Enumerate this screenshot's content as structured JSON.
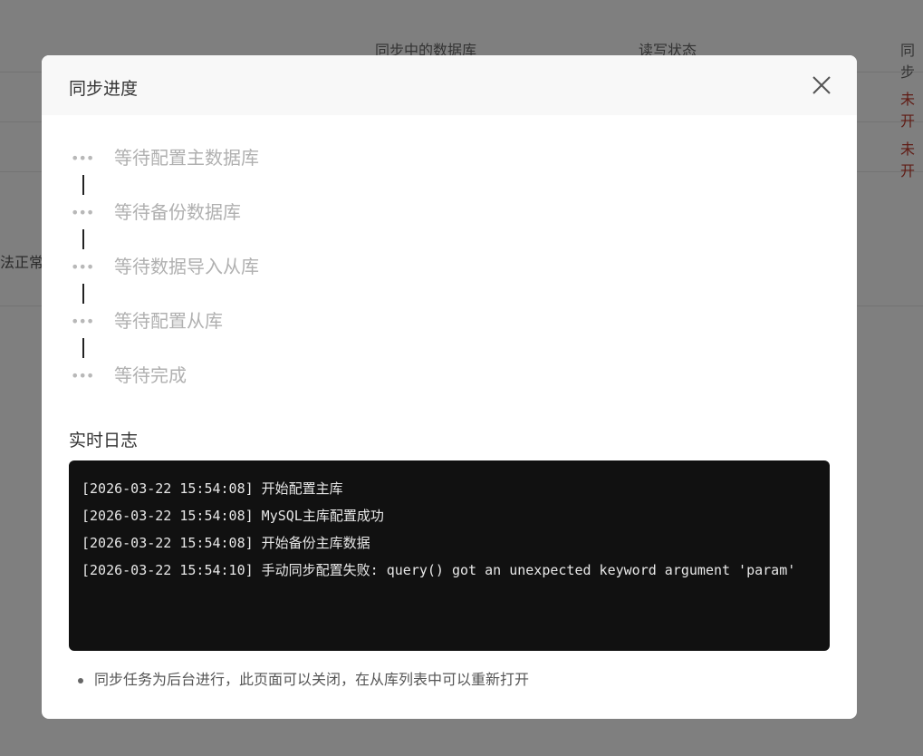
{
  "background": {
    "columns": [
      "同步中的数据库",
      "读写状态",
      "同步"
    ],
    "status_cells": [
      "未开",
      "未开"
    ],
    "side_text": "法正常"
  },
  "modal": {
    "title": "同步进度",
    "close_icon": "close-icon",
    "steps": [
      {
        "label": "等待配置主数据库"
      },
      {
        "label": "等待备份数据库"
      },
      {
        "label": "等待数据导入从库"
      },
      {
        "label": "等待配置从库"
      },
      {
        "label": "等待完成"
      }
    ],
    "step_icon": "•••",
    "log_title": "实时日志",
    "log_lines": [
      "[2026-03-22 15:54:08] 开始配置主库",
      "[2026-03-22 15:54:08] MySQL主库配置成功",
      "[2026-03-22 15:54:08] 开始备份主库数据",
      "[2026-03-22 15:54:10] 手动同步配置失败: query() got an unexpected keyword argument 'param'"
    ],
    "tip": "同步任务为后台进行，此页面可以关闭，在从库列表中可以重新打开"
  }
}
